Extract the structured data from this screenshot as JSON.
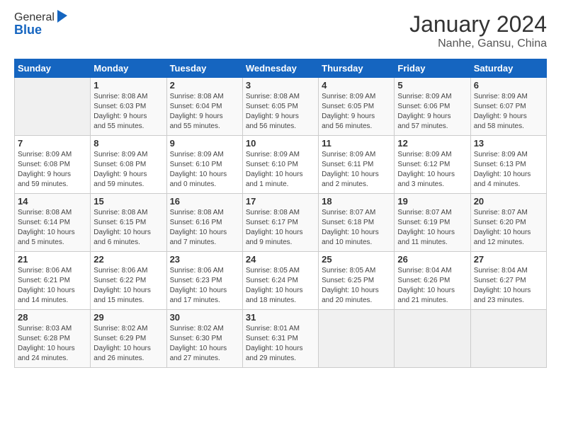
{
  "header": {
    "logo_line1": "General",
    "logo_line2": "Blue",
    "month": "January 2024",
    "location": "Nanhe, Gansu, China"
  },
  "days_of_week": [
    "Sunday",
    "Monday",
    "Tuesday",
    "Wednesday",
    "Thursday",
    "Friday",
    "Saturday"
  ],
  "weeks": [
    [
      {
        "num": "",
        "info": ""
      },
      {
        "num": "1",
        "info": "Sunrise: 8:08 AM\nSunset: 6:03 PM\nDaylight: 9 hours\nand 55 minutes."
      },
      {
        "num": "2",
        "info": "Sunrise: 8:08 AM\nSunset: 6:04 PM\nDaylight: 9 hours\nand 55 minutes."
      },
      {
        "num": "3",
        "info": "Sunrise: 8:08 AM\nSunset: 6:05 PM\nDaylight: 9 hours\nand 56 minutes."
      },
      {
        "num": "4",
        "info": "Sunrise: 8:09 AM\nSunset: 6:05 PM\nDaylight: 9 hours\nand 56 minutes."
      },
      {
        "num": "5",
        "info": "Sunrise: 8:09 AM\nSunset: 6:06 PM\nDaylight: 9 hours\nand 57 minutes."
      },
      {
        "num": "6",
        "info": "Sunrise: 8:09 AM\nSunset: 6:07 PM\nDaylight: 9 hours\nand 58 minutes."
      }
    ],
    [
      {
        "num": "7",
        "info": "Sunrise: 8:09 AM\nSunset: 6:08 PM\nDaylight: 9 hours\nand 59 minutes."
      },
      {
        "num": "8",
        "info": "Sunrise: 8:09 AM\nSunset: 6:08 PM\nDaylight: 9 hours\nand 59 minutes."
      },
      {
        "num": "9",
        "info": "Sunrise: 8:09 AM\nSunset: 6:10 PM\nDaylight: 10 hours\nand 0 minutes."
      },
      {
        "num": "10",
        "info": "Sunrise: 8:09 AM\nSunset: 6:10 PM\nDaylight: 10 hours\nand 1 minute."
      },
      {
        "num": "11",
        "info": "Sunrise: 8:09 AM\nSunset: 6:11 PM\nDaylight: 10 hours\nand 2 minutes."
      },
      {
        "num": "12",
        "info": "Sunrise: 8:09 AM\nSunset: 6:12 PM\nDaylight: 10 hours\nand 3 minutes."
      },
      {
        "num": "13",
        "info": "Sunrise: 8:09 AM\nSunset: 6:13 PM\nDaylight: 10 hours\nand 4 minutes."
      }
    ],
    [
      {
        "num": "14",
        "info": "Sunrise: 8:08 AM\nSunset: 6:14 PM\nDaylight: 10 hours\nand 5 minutes."
      },
      {
        "num": "15",
        "info": "Sunrise: 8:08 AM\nSunset: 6:15 PM\nDaylight: 10 hours\nand 6 minutes."
      },
      {
        "num": "16",
        "info": "Sunrise: 8:08 AM\nSunset: 6:16 PM\nDaylight: 10 hours\nand 7 minutes."
      },
      {
        "num": "17",
        "info": "Sunrise: 8:08 AM\nSunset: 6:17 PM\nDaylight: 10 hours\nand 9 minutes."
      },
      {
        "num": "18",
        "info": "Sunrise: 8:07 AM\nSunset: 6:18 PM\nDaylight: 10 hours\nand 10 minutes."
      },
      {
        "num": "19",
        "info": "Sunrise: 8:07 AM\nSunset: 6:19 PM\nDaylight: 10 hours\nand 11 minutes."
      },
      {
        "num": "20",
        "info": "Sunrise: 8:07 AM\nSunset: 6:20 PM\nDaylight: 10 hours\nand 12 minutes."
      }
    ],
    [
      {
        "num": "21",
        "info": "Sunrise: 8:06 AM\nSunset: 6:21 PM\nDaylight: 10 hours\nand 14 minutes."
      },
      {
        "num": "22",
        "info": "Sunrise: 8:06 AM\nSunset: 6:22 PM\nDaylight: 10 hours\nand 15 minutes."
      },
      {
        "num": "23",
        "info": "Sunrise: 8:06 AM\nSunset: 6:23 PM\nDaylight: 10 hours\nand 17 minutes."
      },
      {
        "num": "24",
        "info": "Sunrise: 8:05 AM\nSunset: 6:24 PM\nDaylight: 10 hours\nand 18 minutes."
      },
      {
        "num": "25",
        "info": "Sunrise: 8:05 AM\nSunset: 6:25 PM\nDaylight: 10 hours\nand 20 minutes."
      },
      {
        "num": "26",
        "info": "Sunrise: 8:04 AM\nSunset: 6:26 PM\nDaylight: 10 hours\nand 21 minutes."
      },
      {
        "num": "27",
        "info": "Sunrise: 8:04 AM\nSunset: 6:27 PM\nDaylight: 10 hours\nand 23 minutes."
      }
    ],
    [
      {
        "num": "28",
        "info": "Sunrise: 8:03 AM\nSunset: 6:28 PM\nDaylight: 10 hours\nand 24 minutes."
      },
      {
        "num": "29",
        "info": "Sunrise: 8:02 AM\nSunset: 6:29 PM\nDaylight: 10 hours\nand 26 minutes."
      },
      {
        "num": "30",
        "info": "Sunrise: 8:02 AM\nSunset: 6:30 PM\nDaylight: 10 hours\nand 27 minutes."
      },
      {
        "num": "31",
        "info": "Sunrise: 8:01 AM\nSunset: 6:31 PM\nDaylight: 10 hours\nand 29 minutes."
      },
      {
        "num": "",
        "info": ""
      },
      {
        "num": "",
        "info": ""
      },
      {
        "num": "",
        "info": ""
      }
    ]
  ]
}
